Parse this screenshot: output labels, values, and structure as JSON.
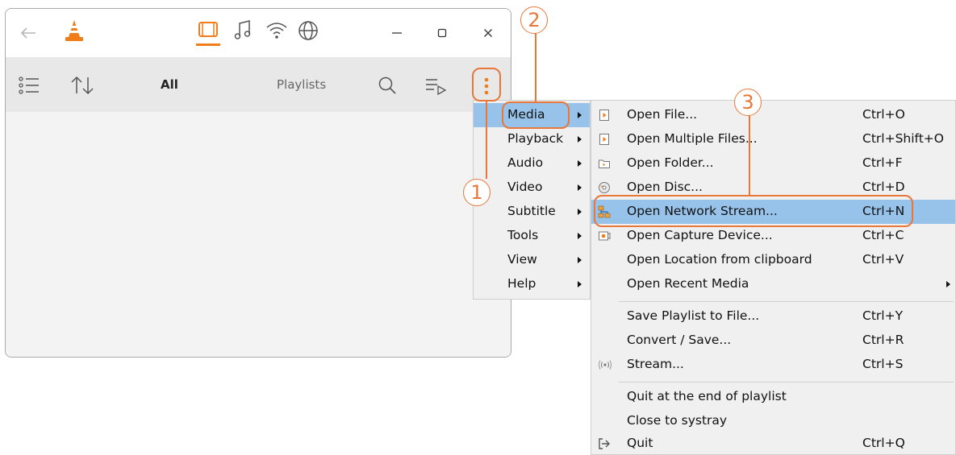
{
  "window": {
    "toolbar": {
      "all_label": "All",
      "playlists_label": "Playlists"
    },
    "title_icons": [
      "back-arrow-icon",
      "vlc-cone-icon",
      "video-icon",
      "music-icon",
      "network-icon",
      "globe-icon"
    ],
    "window_controls": [
      "minimize-icon",
      "maximize-icon",
      "close-icon"
    ]
  },
  "main_menu": {
    "items": [
      {
        "label": "Media",
        "has_submenu": true,
        "active": true
      },
      {
        "label": "Playback",
        "has_submenu": true
      },
      {
        "label": "Audio",
        "has_submenu": true
      },
      {
        "label": "Video",
        "has_submenu": true
      },
      {
        "label": "Subtitle",
        "has_submenu": true
      },
      {
        "label": "Tools",
        "has_submenu": true
      },
      {
        "label": "View",
        "has_submenu": true
      },
      {
        "label": "Help",
        "has_submenu": true
      }
    ]
  },
  "media_menu": {
    "items": [
      {
        "label": "Open File...",
        "shortcut": "Ctrl+O",
        "icon": "open-file-icon"
      },
      {
        "label": "Open Multiple Files...",
        "shortcut": "Ctrl+Shift+O",
        "icon": "open-multiple-files-icon"
      },
      {
        "label": "Open Folder...",
        "shortcut": "Ctrl+F",
        "icon": "open-folder-icon"
      },
      {
        "label": "Open Disc...",
        "shortcut": "Ctrl+D",
        "icon": "open-disc-icon"
      },
      {
        "label": "Open Network Stream...",
        "shortcut": "Ctrl+N",
        "icon": "network-stream-icon",
        "active": true
      },
      {
        "label": "Open Capture Device...",
        "shortcut": "Ctrl+C",
        "icon": "capture-device-icon"
      },
      {
        "label": "Open Location from clipboard",
        "shortcut": "Ctrl+V"
      },
      {
        "label": "Open Recent Media",
        "shortcut": "",
        "has_submenu": true
      },
      {
        "label": "Save Playlist to File...",
        "shortcut": "Ctrl+Y"
      },
      {
        "label": "Convert / Save...",
        "shortcut": "Ctrl+R"
      },
      {
        "label": "Stream...",
        "shortcut": "Ctrl+S",
        "icon": "stream-icon"
      },
      {
        "label": "Quit at the end of playlist",
        "shortcut": ""
      },
      {
        "label": "Close to systray",
        "shortcut": ""
      },
      {
        "label": "Quit",
        "shortcut": "Ctrl+Q",
        "icon": "quit-icon"
      }
    ]
  },
  "annotations": {
    "step1": "1",
    "step2": "2",
    "step3": "3",
    "color": "#e8773b"
  },
  "colors": {
    "highlight": "#97c3ea",
    "accent": "#f07d1a"
  }
}
